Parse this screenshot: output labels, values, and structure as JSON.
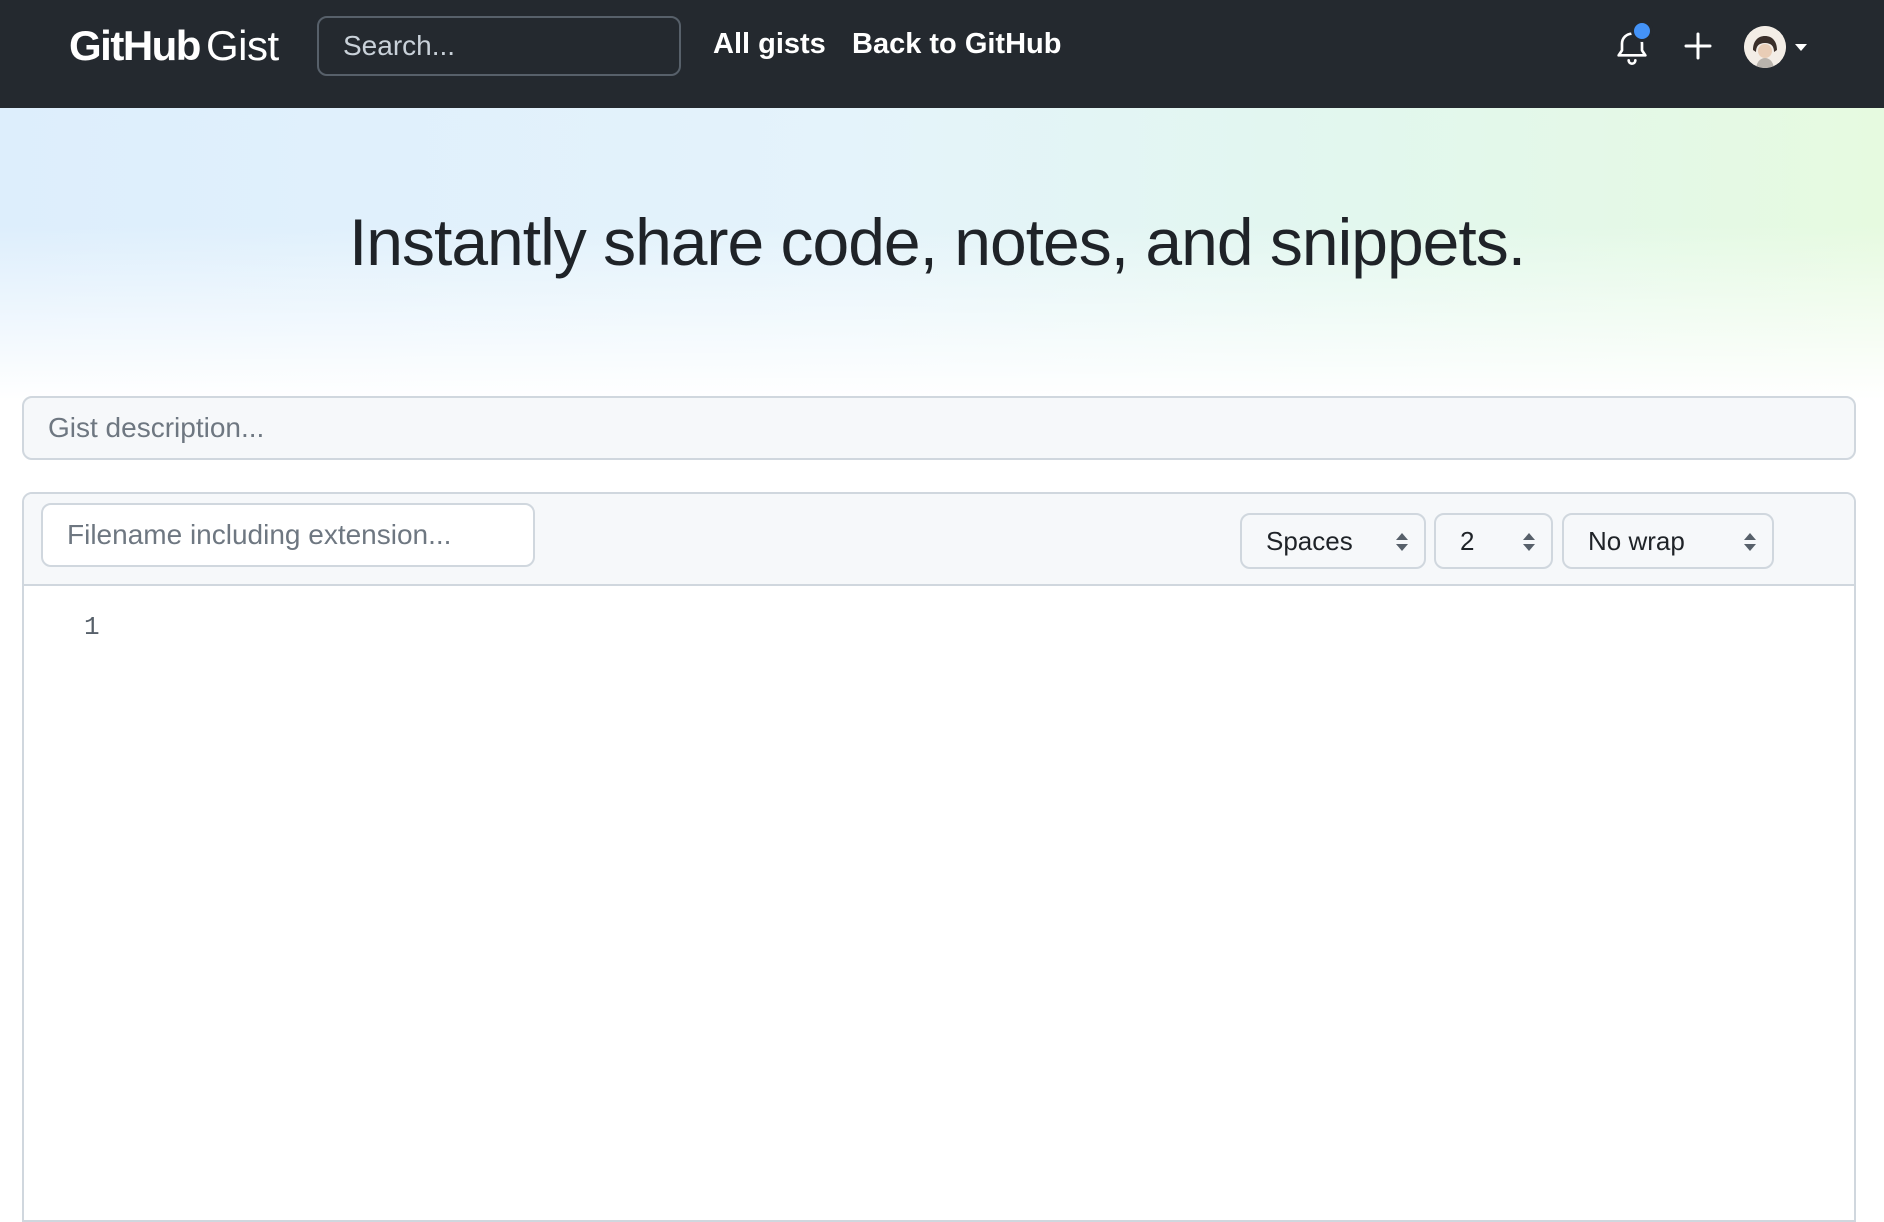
{
  "header": {
    "logo_primary": "GitHub",
    "logo_secondary": "Gist",
    "search_placeholder": "Search...",
    "nav": {
      "all_gists": "All gists",
      "back_to_github": "Back to GitHub"
    },
    "icons": [
      "bell-icon",
      "plus-icon",
      "avatar",
      "caret-down-icon"
    ],
    "notification_dot_color": "#4493f8"
  },
  "hero": {
    "title": "Instantly share code, notes, and snippets."
  },
  "form": {
    "description_placeholder": "Gist description..."
  },
  "editor": {
    "filename_placeholder": "Filename including extension...",
    "indent_mode": "Spaces",
    "indent_size": "2",
    "wrap_mode": "No wrap",
    "line_numbers": [
      "1"
    ]
  },
  "colors": {
    "header_bg": "#24292f",
    "border": "#d0d7de",
    "input_bg": "#f6f8fa"
  }
}
